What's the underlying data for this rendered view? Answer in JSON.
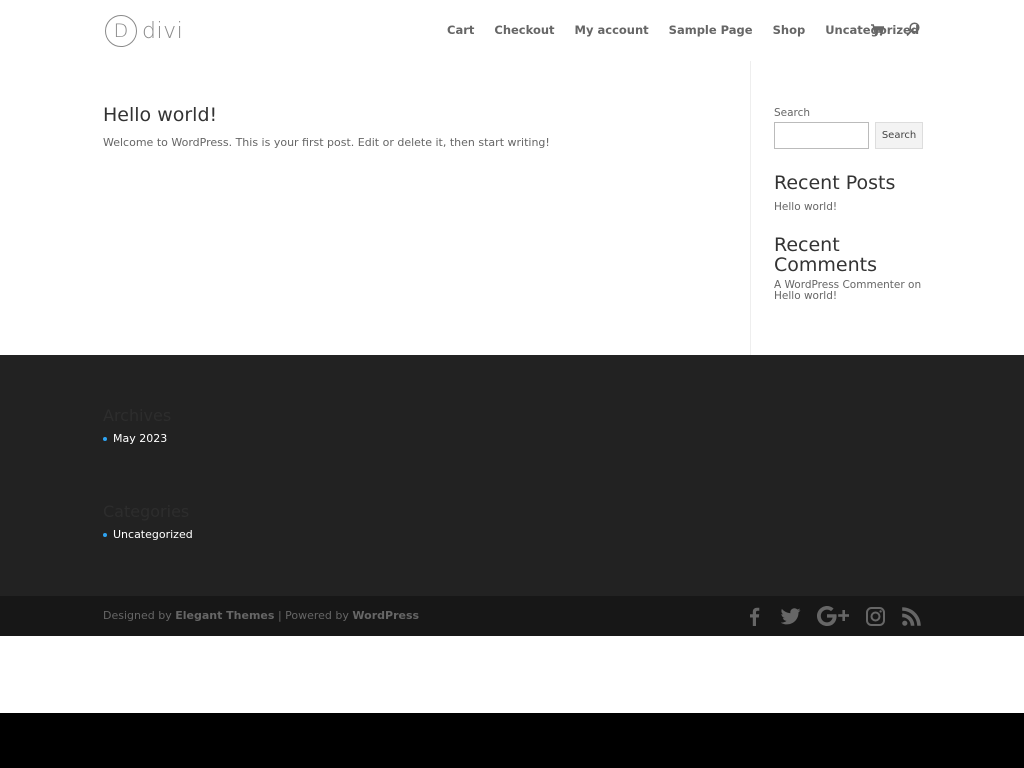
{
  "header": {
    "logo_mark": "D",
    "logo_text": "divi",
    "nav": [
      "Cart",
      "Checkout",
      "My account",
      "Sample Page",
      "Shop",
      "Uncategorized"
    ],
    "cart_icon": "shopping-cart-icon",
    "search_icon": "search-icon"
  },
  "post": {
    "title": "Hello world!",
    "excerpt": "Welcome to WordPress. This is your first post. Edit or delete it, then start writing!"
  },
  "sidebar": {
    "search_label": "Search",
    "search_value": "",
    "search_button": "Search",
    "recent_posts_title": "Recent Posts",
    "recent_posts": [
      "Hello world!"
    ],
    "recent_comments_title": "Recent Comments",
    "comment_author": "A WordPress Commenter",
    "comment_on": "on",
    "comment_post": "Hello world!"
  },
  "footer": {
    "archives_title": "Archives",
    "archives": [
      "May 2023"
    ],
    "categories_title": "Categories",
    "categories": [
      "Uncategorized"
    ]
  },
  "bottom": {
    "designed_by": "Designed by ",
    "elegant_themes": "Elegant Themes",
    "separator": " | Powered by ",
    "wordpress": "WordPress",
    "social_icons": [
      "facebook-icon",
      "twitter-icon",
      "google-plus-icon",
      "instagram-icon",
      "rss-icon"
    ]
  },
  "colors": {
    "accent": "#2ea3f2",
    "footer_bg": "#222222",
    "bottom_bar_bg": "#171717"
  }
}
